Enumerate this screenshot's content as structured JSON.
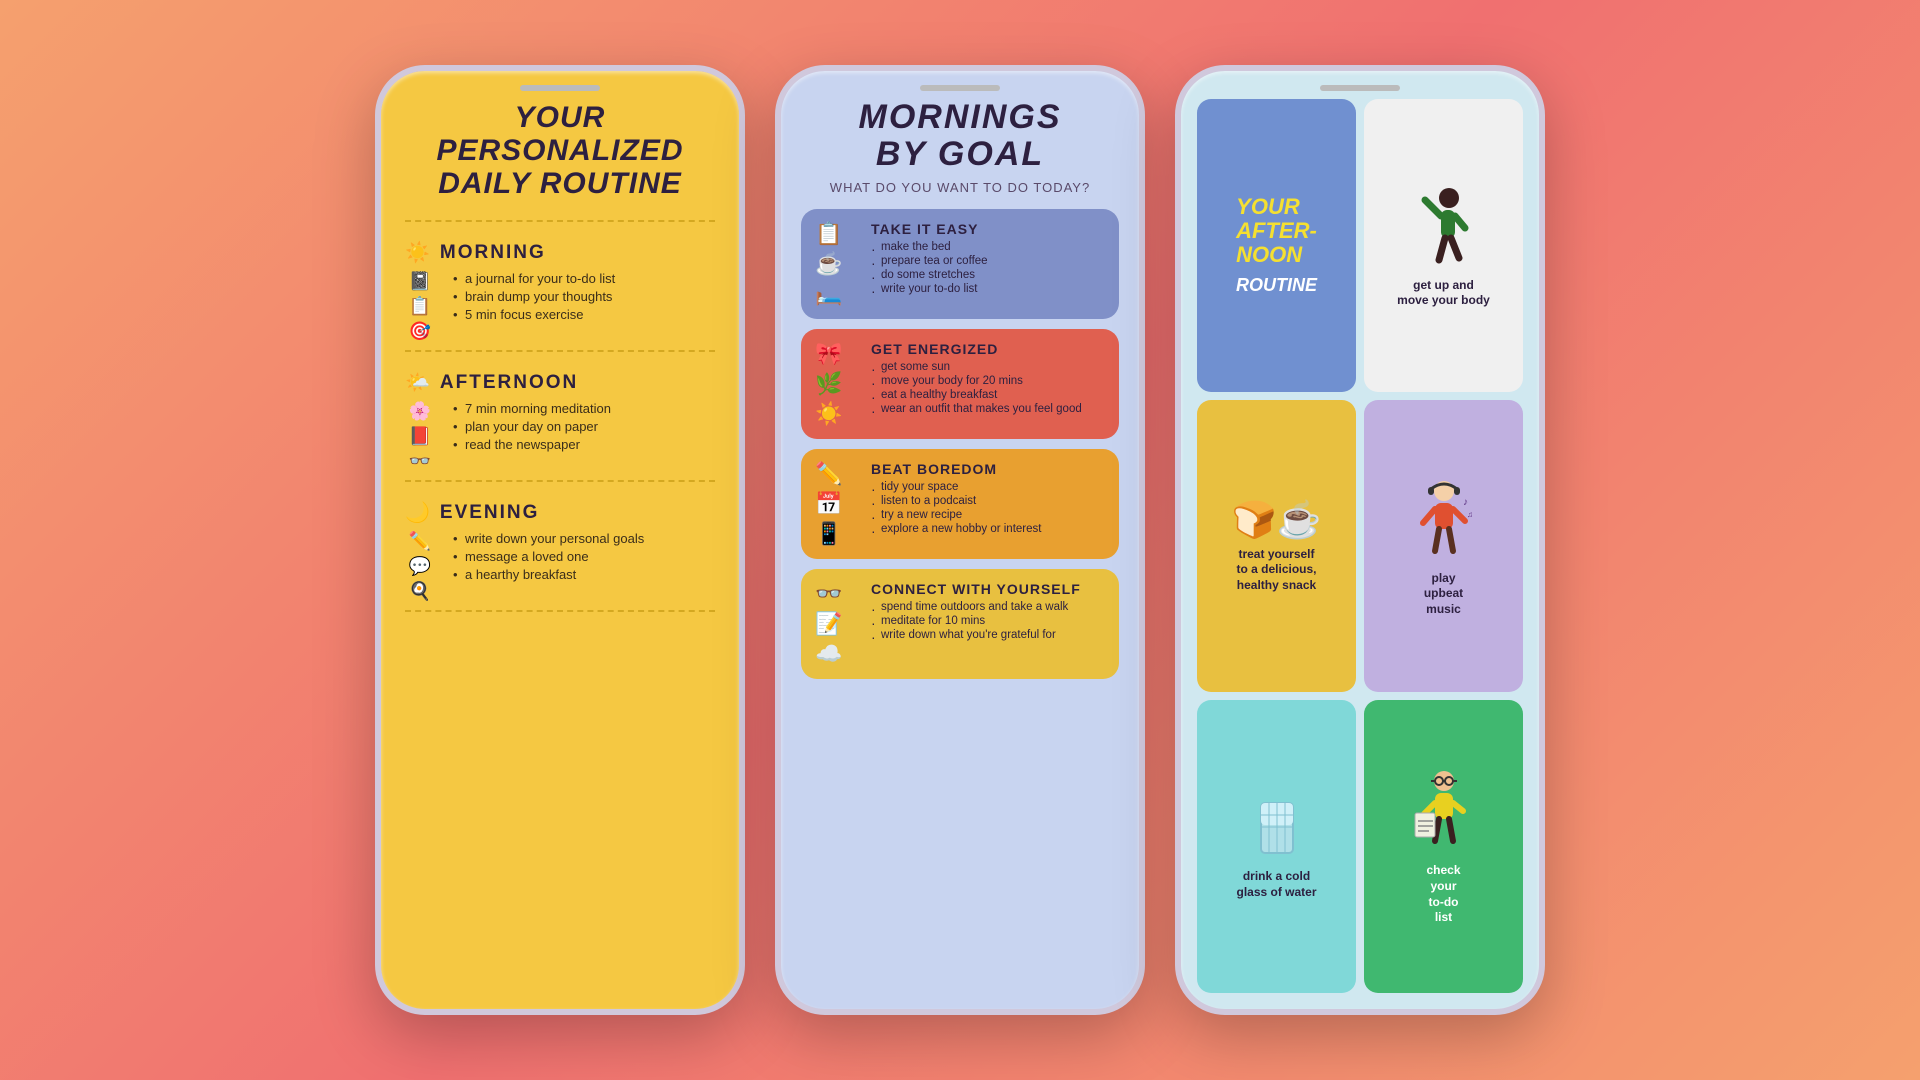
{
  "background": {
    "gradient": "coral-peach"
  },
  "phone1": {
    "title": "YOUR\nPERSONALIZED\nDAILY ROUTINE",
    "sections": [
      {
        "id": "morning",
        "label": "MORNING",
        "icon": "☀️",
        "items": [
          "a journal for your to-do list",
          "brain dump your thoughts",
          "5 min focus exercise"
        ]
      },
      {
        "id": "afternoon",
        "label": "AFTERNOON",
        "icon": "🌤️",
        "items": [
          "7 min morning meditation",
          "plan your day on paper",
          "read the newspaper"
        ]
      },
      {
        "id": "evening",
        "label": "EVENING",
        "icon": "🌙",
        "items": [
          "write down your personal goals",
          "message a loved one",
          "a hearthy breakfast"
        ]
      }
    ]
  },
  "phone2": {
    "title": "MORNINGS\nBY GOAL",
    "subtitle": "WHAT DO YOU WANT TO DO TODAY?",
    "goals": [
      {
        "id": "take-it-easy",
        "title": "TAKE IT EASY",
        "color": "blue",
        "icons": [
          "📋",
          "☕"
        ],
        "items": [
          "make the bed",
          "prepare tea or coffee",
          "do some stretches",
          "write your to-do list"
        ]
      },
      {
        "id": "get-energized",
        "title": "GET ENERGIZED",
        "color": "red",
        "icons": [
          "🎀",
          "🌿"
        ],
        "items": [
          "get some sun",
          "move your body for 20 mins",
          "eat a healthy breakfast",
          "wear an outfit that makes you feel good"
        ]
      },
      {
        "id": "beat-boredom",
        "title": "BEAT BOREDOM",
        "color": "orange",
        "icons": [
          "✏️",
          "📅"
        ],
        "items": [
          "tidy your space",
          "listen to a podcaist",
          "try a new recipe",
          "explore a new hobby or interest"
        ]
      },
      {
        "id": "connect-yourself",
        "title": "CONNECT WITH YOURSELF",
        "color": "yellow",
        "icons": [
          "👓",
          "📝"
        ],
        "items": [
          "spend time outdoors and take a walk",
          "meditate for 10 mins",
          "write down what you're grateful for"
        ]
      }
    ]
  },
  "phone3": {
    "title": "YOUR\nAFTER-\nNOON\nROUTINE",
    "cells": [
      {
        "id": "title-card",
        "type": "title"
      },
      {
        "id": "move-body",
        "label": "get up and\nmove your body",
        "emoji": "🧍",
        "bg": "light"
      },
      {
        "id": "snack",
        "label": "treat yourself\nto a delicious,\nhealthy snack",
        "emoji": "🍞",
        "bg": "yellow"
      },
      {
        "id": "music",
        "label": "play\nupbeat\nmusic",
        "emoji": "🎧",
        "bg": "purple"
      },
      {
        "id": "water",
        "label": "drink a cold\nglass of water",
        "emoji": "🥛",
        "bg": "teal"
      },
      {
        "id": "todo",
        "label": "check\nyour\nto-do\nlist",
        "emoji": "📋",
        "bg": "green"
      }
    ]
  }
}
